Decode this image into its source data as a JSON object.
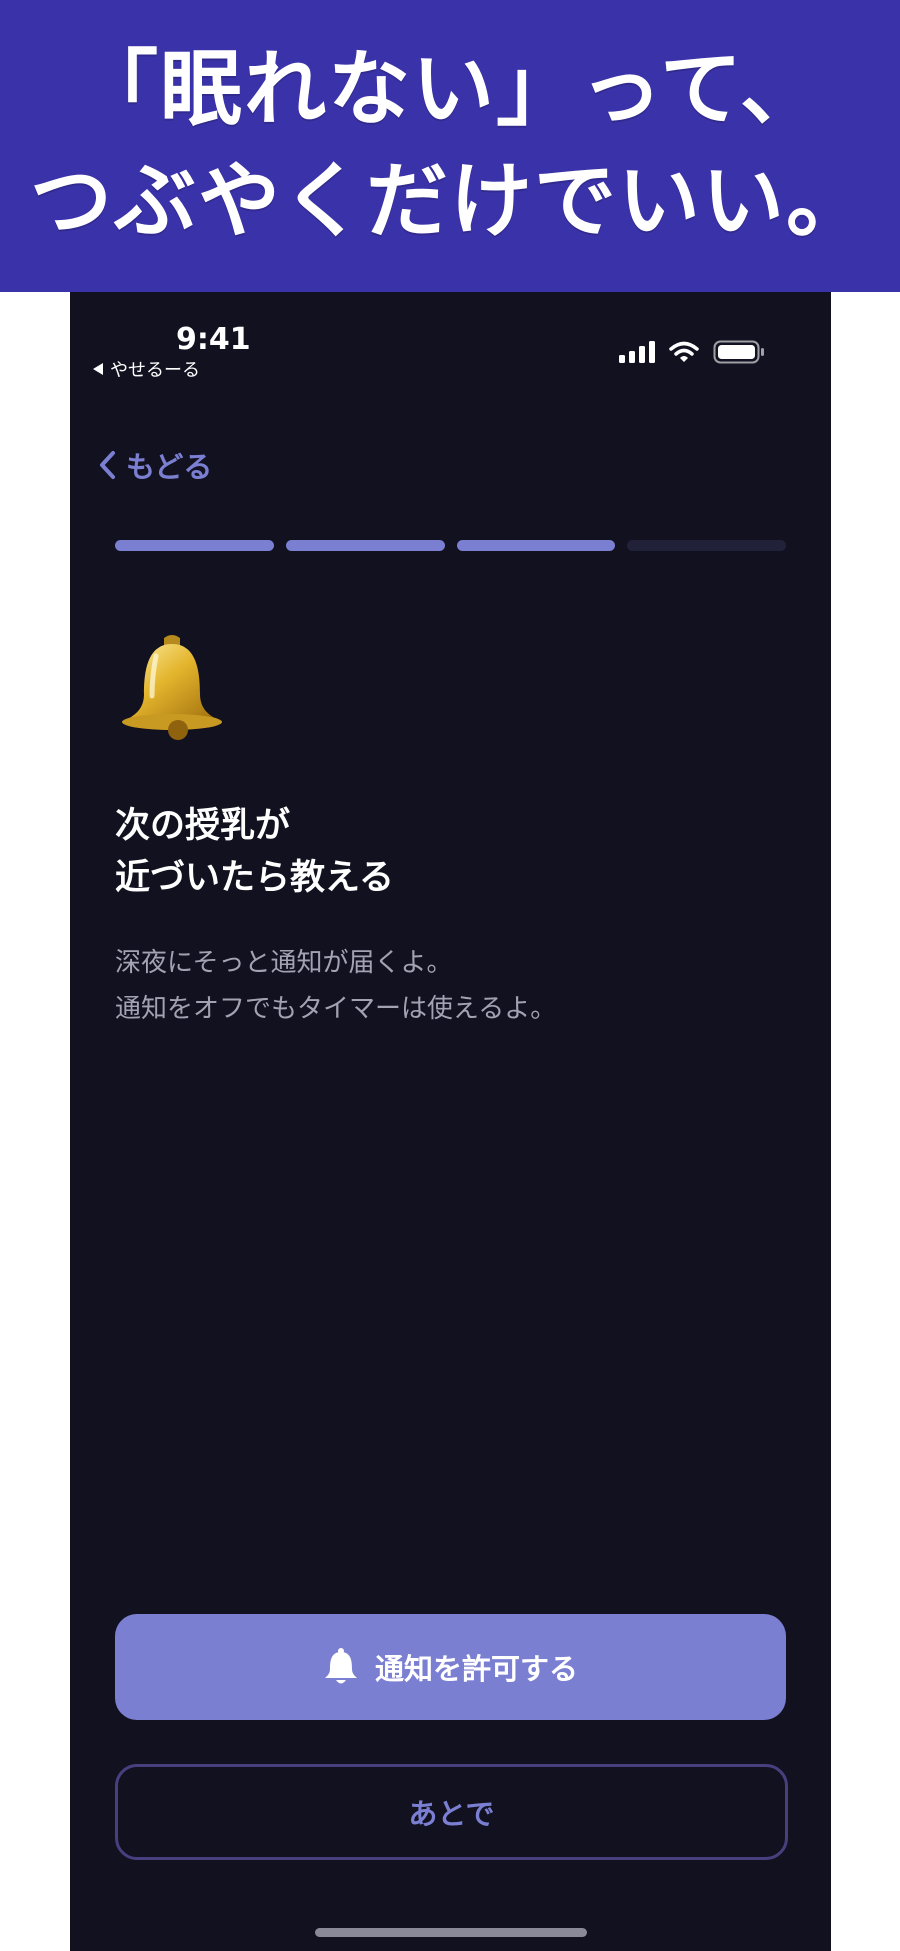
{
  "banner": {
    "line1": "「眠れない」って、",
    "line2": "つぶやくだけでいい。",
    "background": "#3a32a8"
  },
  "status_bar": {
    "time": "9:41",
    "back_app": "やせるーる"
  },
  "nav": {
    "back_label": "もどる"
  },
  "progress": {
    "total_steps": 4,
    "completed_steps": 3,
    "active_color": "#7b7fd2",
    "inactive_color": "#22213a"
  },
  "content": {
    "icon": "bell-emoji",
    "title_line1": "次の授乳が",
    "title_line2": "近づいたら教える",
    "desc_line1": "深夜にそっと通知が届くよ。",
    "desc_line2": "通知をオフでもタイマーは使えるよ。"
  },
  "buttons": {
    "allow_icon": "bell-icon",
    "allow_label": "通知を許可する",
    "later_label": "あとで"
  },
  "colors": {
    "accent": "#7b7fd2",
    "background": "#12111f",
    "secondary_border": "#46407e"
  }
}
